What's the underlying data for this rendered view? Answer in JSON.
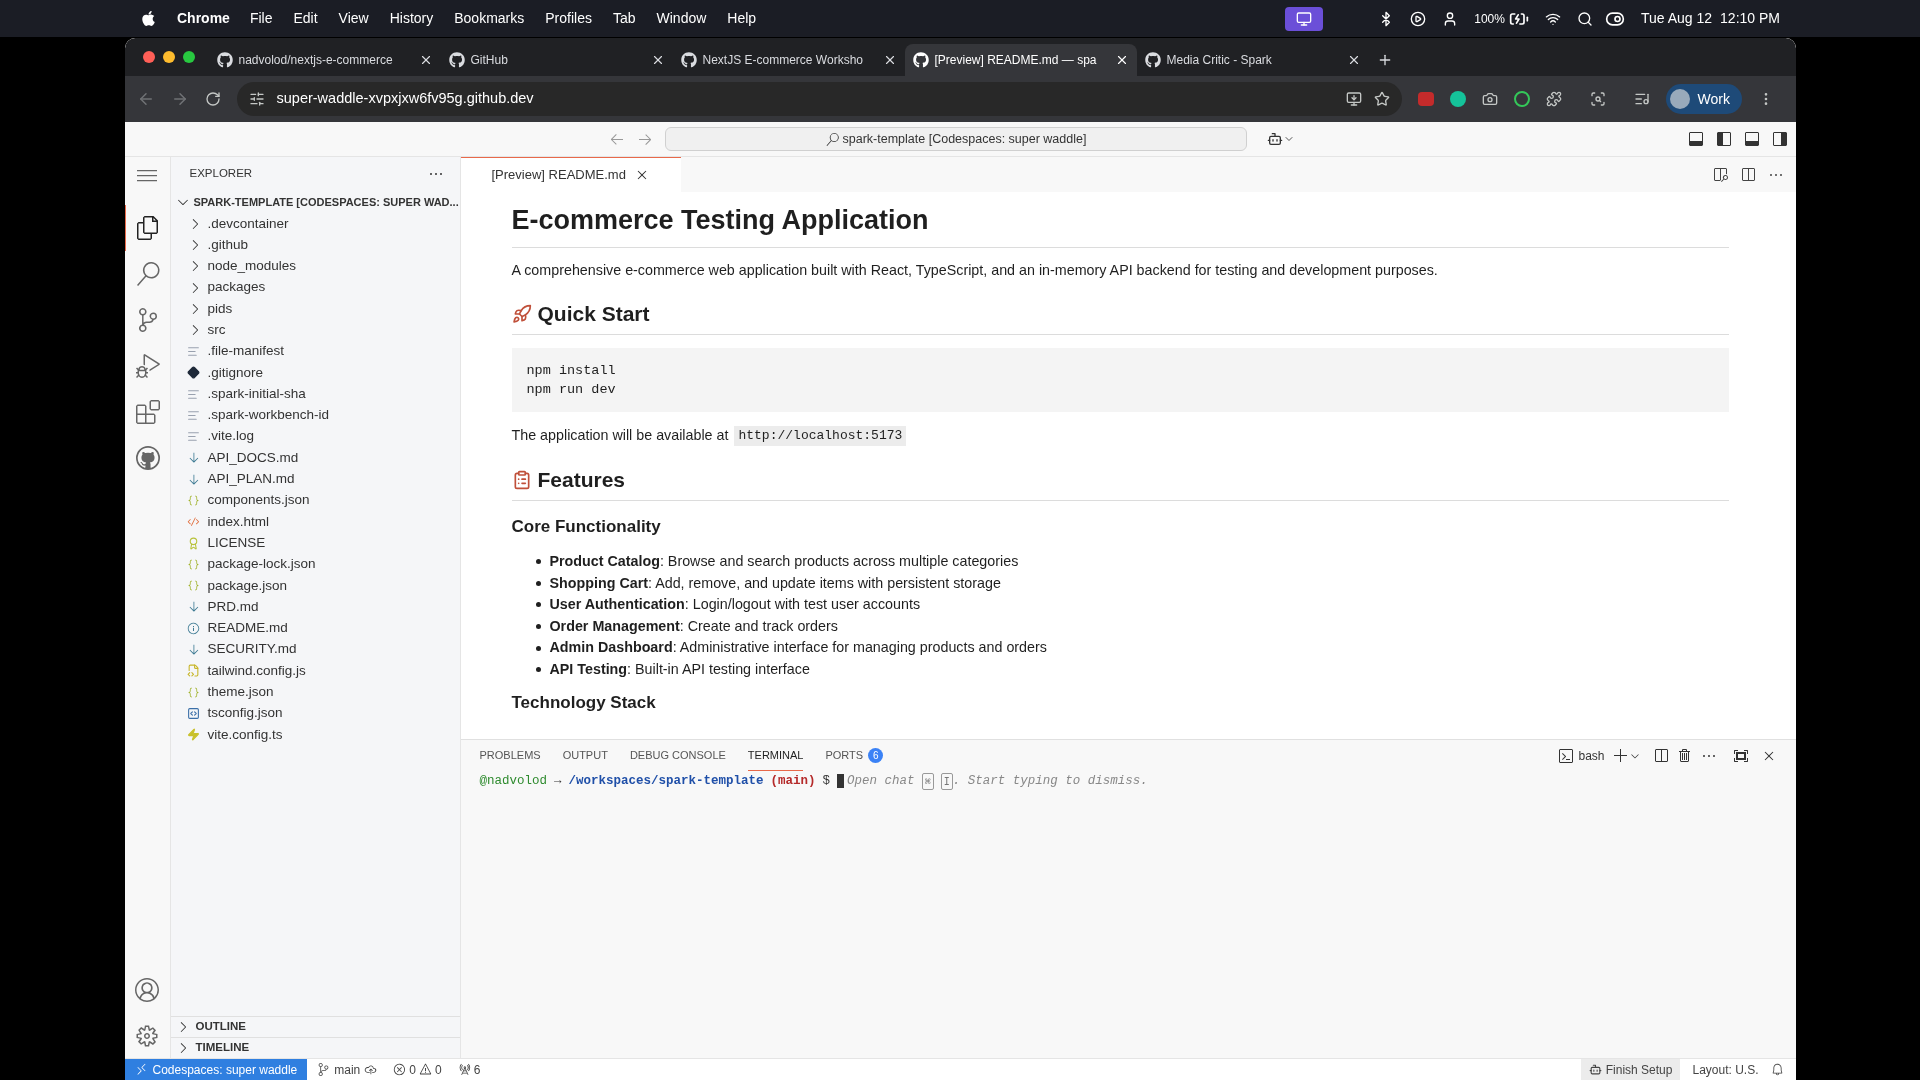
{
  "menu_bar": {
    "app": "Chrome",
    "items": [
      "File",
      "Edit",
      "View",
      "History",
      "Bookmarks",
      "Profiles",
      "Tab",
      "Window",
      "Help"
    ],
    "battery": "100%",
    "date": "Tue Aug 12",
    "time": "12:10 PM"
  },
  "browser": {
    "tabs": [
      {
        "title": "nadvolod/nextjs-e-commerce",
        "selected": false
      },
      {
        "title": "GitHub",
        "selected": false
      },
      {
        "title": "NextJS E-commerce Worksho",
        "selected": false
      },
      {
        "title": "[Preview] README.md — spa",
        "selected": true
      },
      {
        "title": "Media Critic - Spark",
        "selected": false
      }
    ],
    "address": "super-waddle-xvpxjxw6fv95g.github.dev",
    "profile": "Work"
  },
  "command_center": "spark-template [Codespaces: super waddle]",
  "activity_bar": [
    {
      "kind": "explorer",
      "selected": true
    },
    {
      "kind": "search",
      "selected": false
    },
    {
      "kind": "source-control",
      "selected": false
    },
    {
      "kind": "debug",
      "selected": false
    },
    {
      "kind": "extensions",
      "selected": false
    },
    {
      "kind": "github",
      "selected": false
    }
  ],
  "explorer": {
    "title": "EXPLORER",
    "root": "SPARK-TEMPLATE [CODESPACES: SUPER WAD...",
    "expanded": true,
    "items": [
      {
        "name": ".devcontainer",
        "kind": "folder",
        "expanded": false
      },
      {
        "name": ".github",
        "kind": "folder",
        "expanded": false
      },
      {
        "name": "node_modules",
        "kind": "folder",
        "expanded": false
      },
      {
        "name": "packages",
        "kind": "folder",
        "expanded": false
      },
      {
        "name": "pids",
        "kind": "folder",
        "expanded": false
      },
      {
        "name": "src",
        "kind": "folder",
        "expanded": false
      },
      {
        "name": ".file-manifest",
        "kind": "text"
      },
      {
        "name": ".gitignore",
        "kind": "git"
      },
      {
        "name": ".spark-initial-sha",
        "kind": "text"
      },
      {
        "name": ".spark-workbench-id",
        "kind": "text"
      },
      {
        "name": ".vite.log",
        "kind": "text"
      },
      {
        "name": "API_DOCS.md",
        "kind": "markdown"
      },
      {
        "name": "API_PLAN.md",
        "kind": "markdown"
      },
      {
        "name": "components.json",
        "kind": "json"
      },
      {
        "name": "index.html",
        "kind": "html"
      },
      {
        "name": "LICENSE",
        "kind": "license"
      },
      {
        "name": "package-lock.json",
        "kind": "json"
      },
      {
        "name": "package.json",
        "kind": "json"
      },
      {
        "name": "PRD.md",
        "kind": "markdown"
      },
      {
        "name": "README.md",
        "kind": "info"
      },
      {
        "name": "SECURITY.md",
        "kind": "markdown"
      },
      {
        "name": "tailwind.config.js",
        "kind": "js"
      },
      {
        "name": "theme.json",
        "kind": "json"
      },
      {
        "name": "tsconfig.json",
        "kind": "ts"
      },
      {
        "name": "vite.config.ts",
        "kind": "vite"
      }
    ],
    "sections": [
      {
        "label": "OUTLINE",
        "expanded": false
      },
      {
        "label": "TIMELINE",
        "expanded": false
      }
    ]
  },
  "editor_tab": {
    "label": "[Preview] README.md",
    "selected": true
  },
  "preview": [
    {
      "kind": "h1",
      "text": "E-commerce Testing Application"
    },
    {
      "kind": "p",
      "text": "A comprehensive e-commerce web application built with React, TypeScript, and an in-memory API backend for testing and development purposes."
    },
    {
      "kind": "h2",
      "text": "Quick Start"
    },
    {
      "kind": "code",
      "lines": [
        "npm install",
        "npm run dev"
      ]
    },
    {
      "kind": "p_code",
      "text": "The application will be available at",
      "code": "http://localhost:5173"
    },
    {
      "kind": "h2",
      "text": "Features"
    },
    {
      "kind": "h3",
      "text": "Core Functionality"
    },
    {
      "kind": "list",
      "items": [
        "**Product Catalog**: Browse and search products across multiple categories",
        "**Shopping Cart**: Add, remove, and update items with persistent storage",
        "**User Authentication**: Login/logout with test user accounts",
        "**Order Management**: Create and track orders",
        "**Admin Dashboard**: Administrative interface for managing products and orders",
        "**API Testing**: Built-in API testing interface"
      ]
    },
    {
      "kind": "h3",
      "text": "Technology Stack"
    }
  ],
  "panel": {
    "tabs": [
      {
        "label": "PROBLEMS",
        "selected": false
      },
      {
        "label": "OUTPUT",
        "selected": false
      },
      {
        "label": "DEBUG CONSOLE",
        "selected": false
      },
      {
        "label": "TERMINAL",
        "selected": true
      },
      {
        "label": "PORTS",
        "selected": false,
        "badge": "6"
      }
    ],
    "shell": "bash",
    "terminal": {
      "user": "@nadvolod",
      "arrow": "→",
      "path": "/workspaces/spark-template",
      "branch": "(main)",
      "prompt": "$",
      "hint": "Open chat",
      "keys": [
        "⌘",
        "I"
      ],
      "hint_end": ". Start typing to dismiss."
    }
  },
  "status_bar": {
    "remote": "Codespaces: super waddle",
    "branch": "main",
    "errors": "0",
    "warnings": "0",
    "ports": "6",
    "finish": "Finish Setup",
    "layout": "Layout: U.S."
  }
}
